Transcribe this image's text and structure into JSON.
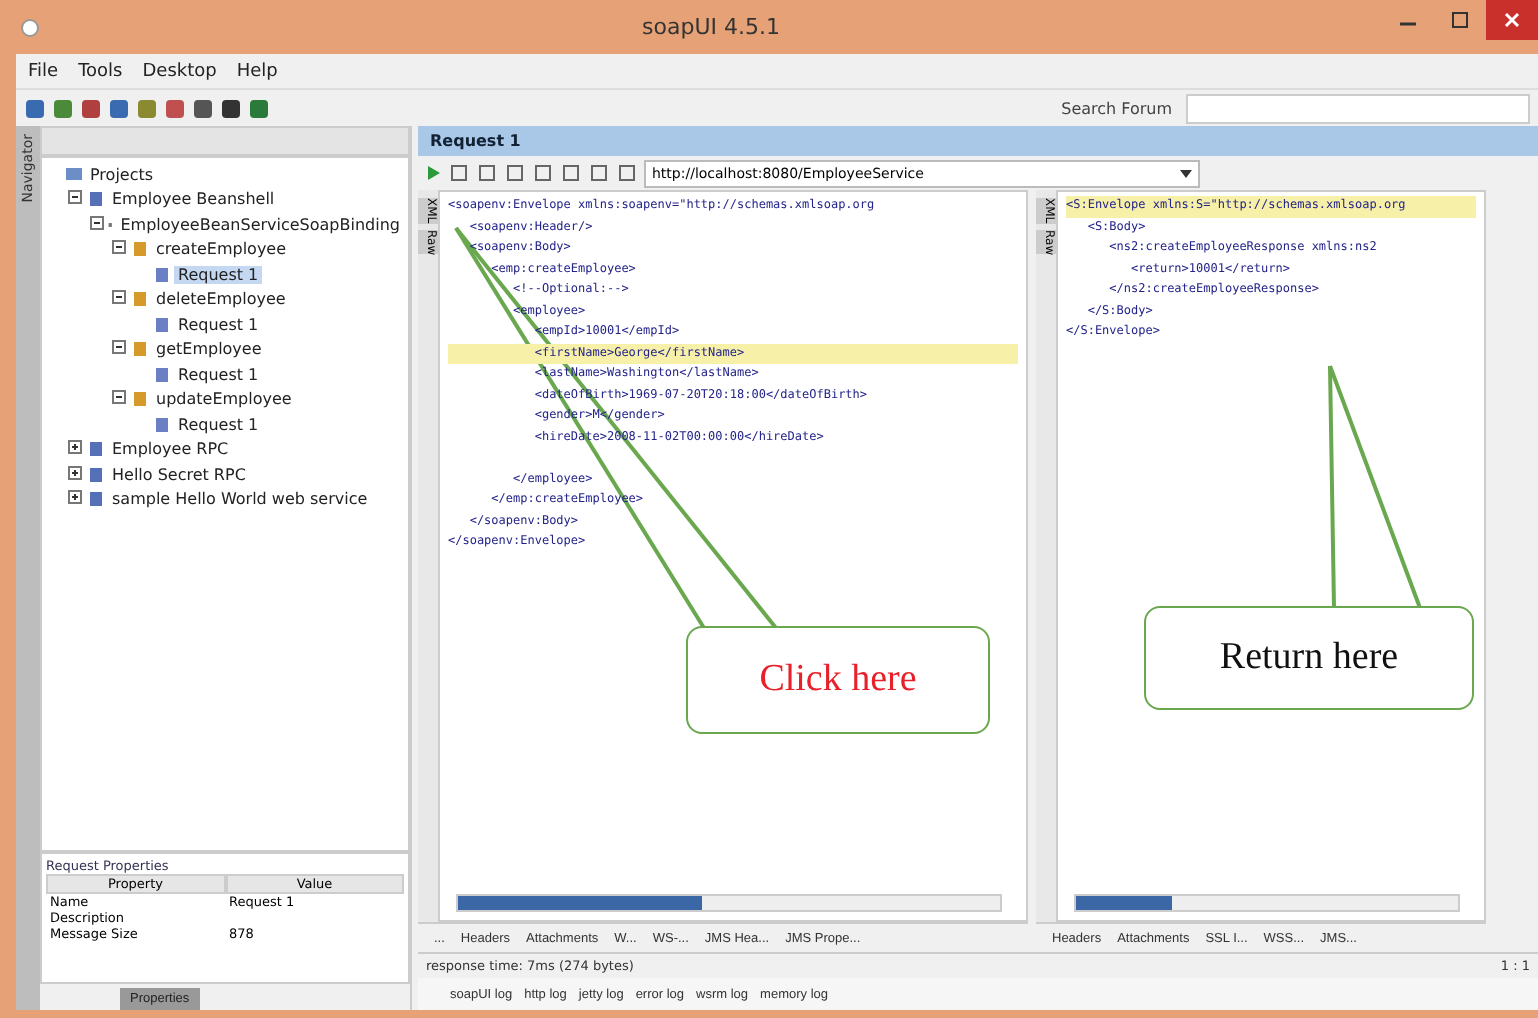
{
  "window": {
    "title": "soapUI 4.5.1"
  },
  "menu": [
    "File",
    "Tools",
    "Desktop",
    "Help"
  ],
  "search": {
    "label": "Search Forum"
  },
  "navigator": {
    "tab": "Navigator",
    "header": "Projects",
    "tree": [
      {
        "label": "Employee Beanshell",
        "kind": "project",
        "expanded": true,
        "selected": false,
        "children": [
          {
            "label": "EmployeeBeanServiceSoapBinding",
            "kind": "interface",
            "expanded": true,
            "selected": false,
            "children": [
              {
                "label": "createEmployee",
                "kind": "operation",
                "expanded": true,
                "selected": false,
                "children": [
                  {
                    "label": "Request 1",
                    "kind": "request",
                    "selected": true
                  }
                ]
              },
              {
                "label": "deleteEmployee",
                "kind": "operation",
                "expanded": true,
                "selected": false,
                "children": [
                  {
                    "label": "Request 1",
                    "kind": "request",
                    "selected": false
                  }
                ]
              },
              {
                "label": "getEmployee",
                "kind": "operation",
                "expanded": true,
                "selected": false,
                "children": [
                  {
                    "label": "Request 1",
                    "kind": "request",
                    "selected": false
                  }
                ]
              },
              {
                "label": "updateEmployee",
                "kind": "operation",
                "expanded": true,
                "selected": false,
                "children": [
                  {
                    "label": "Request 1",
                    "kind": "request",
                    "selected": false
                  }
                ]
              }
            ]
          }
        ]
      },
      {
        "label": "Employee RPC",
        "kind": "project",
        "expanded": false,
        "selected": false
      },
      {
        "label": "Hello Secret RPC",
        "kind": "project",
        "expanded": false,
        "selected": false
      },
      {
        "label": "sample Hello World web service",
        "kind": "project",
        "expanded": false,
        "selected": false
      }
    ]
  },
  "properties": {
    "title": "Request Properties",
    "columns": [
      "Property",
      "Value"
    ],
    "rows": [
      [
        "Name",
        "Request 1"
      ],
      [
        "Description",
        ""
      ],
      [
        "Message Size",
        "878"
      ]
    ],
    "tab": "Properties"
  },
  "editor": {
    "title": "Request 1",
    "url": "http://localhost:8080/EmployeeService",
    "request_side_tabs": [
      "XML",
      "Raw"
    ],
    "request_lines": [
      {
        "text": "<soapenv:Envelope xmlns:soapenv=\"http://schemas.xmlsoap.org",
        "highlighted": false
      },
      {
        "text": "   <soapenv:Header/>",
        "highlighted": false
      },
      {
        "text": "   <soapenv:Body>",
        "highlighted": false
      },
      {
        "text": "      <emp:createEmployee>",
        "highlighted": false
      },
      {
        "text": "         <!--Optional:-->",
        "highlighted": false
      },
      {
        "text": "         <employee>",
        "highlighted": false
      },
      {
        "text": "            <empId>10001</empId>",
        "highlighted": false
      },
      {
        "text": "            <firstName>George</firstName>",
        "highlighted": true
      },
      {
        "text": "            <lastName>Washington</lastName>",
        "highlighted": false
      },
      {
        "text": "            <dateOfBirth>1969-07-20T20:18:00</dateOfBirth>",
        "highlighted": false
      },
      {
        "text": "            <gender>M</gender>",
        "highlighted": false
      },
      {
        "text": "            <hireDate>2008-11-02T00:00:00</hireDate>",
        "highlighted": false
      },
      {
        "text": "         </employee>",
        "highlighted": false
      },
      {
        "text": "      </emp:createEmployee>",
        "highlighted": false
      },
      {
        "text": "   </soapenv:Body>",
        "highlighted": false
      },
      {
        "text": "</soapenv:Envelope>",
        "highlighted": false
      }
    ],
    "request_tabs": [
      "...",
      "Headers",
      "Attachments",
      "W...",
      "WS-...",
      "JMS Hea...",
      "JMS Prope..."
    ],
    "response_side_tabs": [
      "XML",
      "Raw"
    ],
    "response_lines": [
      {
        "text": "<S:Envelope xmlns:S=\"http://schemas.xmlsoap.org",
        "highlighted": true
      },
      {
        "text": "   <S:Body>",
        "highlighted": false
      },
      {
        "text": "      <ns2:createEmployeeResponse xmlns:ns2",
        "highlighted": false
      },
      {
        "text": "         <return>10001</return>",
        "highlighted": false
      },
      {
        "text": "      </ns2:createEmployeeResponse>",
        "highlighted": false
      },
      {
        "text": "   </S:Body>",
        "highlighted": false
      },
      {
        "text": "</S:Envelope>",
        "highlighted": false
      }
    ],
    "response_tabs": [
      "Headers",
      "Attachments",
      "SSL I...",
      "WSS...",
      "JMS..."
    ],
    "status": "response time: 7ms (274 bytes)",
    "position": "1 : 1"
  },
  "logs": [
    "soapUI log",
    "http log",
    "jetty log",
    "error log",
    "wsrm log",
    "memory log"
  ],
  "callouts": [
    {
      "text": "Click here",
      "color": "#e8202a"
    },
    {
      "text": "Return here",
      "color": "#111111"
    }
  ]
}
